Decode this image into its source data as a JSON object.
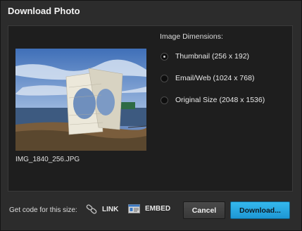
{
  "dialog": {
    "title": "Download Photo"
  },
  "photo": {
    "filename": "IMG_1840_256.JPG"
  },
  "dimensions": {
    "label": "Image Dimensions:",
    "options": [
      {
        "label": "Thumbnail (256 x 192)",
        "checked": true
      },
      {
        "label": "Email/Web (1024 x 768)",
        "checked": false
      },
      {
        "label": "Original Size (2048 x 1536)",
        "checked": false
      }
    ]
  },
  "footer": {
    "get_code_label": "Get code for this size:",
    "link_label": "LINK",
    "embed_label": "EMBED",
    "cancel_label": "Cancel",
    "download_label": "Download..."
  },
  "colors": {
    "accent": "#2aa8e3",
    "background": "#2c2c2c",
    "panel": "#1e1e1e"
  }
}
